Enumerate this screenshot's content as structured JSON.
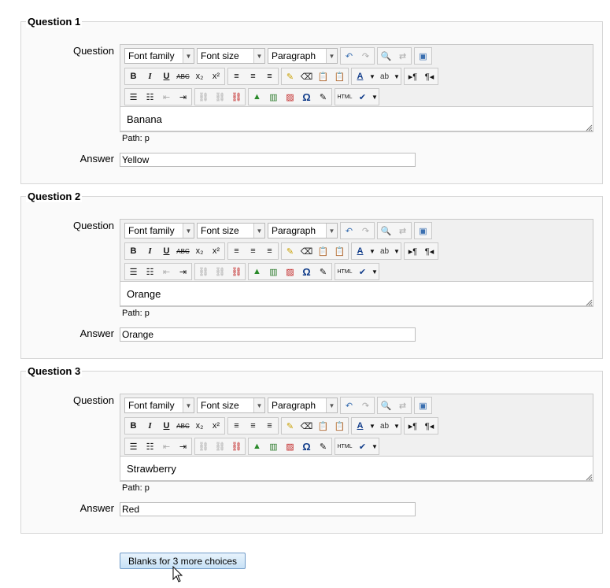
{
  "editor_labels": {
    "question": "Question",
    "answer": "Answer",
    "path": "Path: p"
  },
  "toolbar": {
    "font_family": "Font family",
    "font_size": "Font size",
    "format": "Paragraph",
    "bold": "B",
    "italic": "I",
    "underline": "U",
    "strike": "ABC",
    "sub": "x₂",
    "sup": "x²",
    "omega": "Ω",
    "html": "HTML"
  },
  "questions": [
    {
      "legend": "Question 1",
      "question_text": "Banana",
      "answer": "Yellow"
    },
    {
      "legend": "Question 2",
      "question_text": "Orange",
      "answer": "Orange"
    },
    {
      "legend": "Question 3",
      "question_text": "Strawberry",
      "answer": "Red"
    }
  ],
  "more_button": {
    "label": "Blanks for 3 more choices"
  }
}
